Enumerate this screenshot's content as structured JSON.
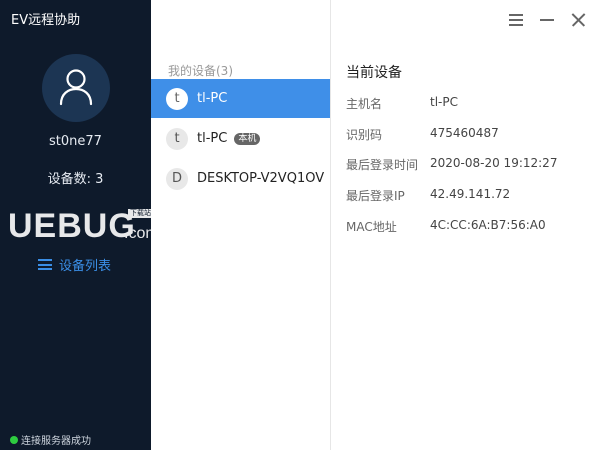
{
  "app": {
    "title": "EV远程协助"
  },
  "sidebar": {
    "username": "st0ne77",
    "device_count": "设备数: 3",
    "nav_device_list": "设备列表",
    "watermark": {
      "big": "UEBUG",
      "small": ".com",
      "tag": "下载站"
    },
    "status": "连接服务器成功"
  },
  "devices": {
    "section_label": "我的设备(3)",
    "items": [
      {
        "letter": "t",
        "name": "tl-PC",
        "badge": "",
        "selected": true
      },
      {
        "letter": "t",
        "name": "tl-PC",
        "badge": "本机",
        "selected": false
      },
      {
        "letter": "D",
        "name": "DESKTOP-V2VQ1OV",
        "badge": "",
        "selected": false
      }
    ]
  },
  "details": {
    "title": "当前设备",
    "rows": [
      {
        "label": "主机名",
        "value": "tl-PC"
      },
      {
        "label": "识别码",
        "value": "475460487"
      },
      {
        "label": "最后登录时间",
        "value": "2020-08-20 19:12:27"
      },
      {
        "label": "最后登录IP",
        "value": "42.49.141.72"
      },
      {
        "label": "MAC地址",
        "value": "4C:CC:6A:B7:56:A0"
      }
    ]
  },
  "window_controls": {
    "menu": "menu-icon",
    "minimize": "minimize-icon",
    "close": "close-icon"
  },
  "colors": {
    "sidebar_bg": "#0e1a2b",
    "accent": "#3f8fe8",
    "nav_text": "#3a8ee6",
    "status_dot": "#2ecc40"
  }
}
